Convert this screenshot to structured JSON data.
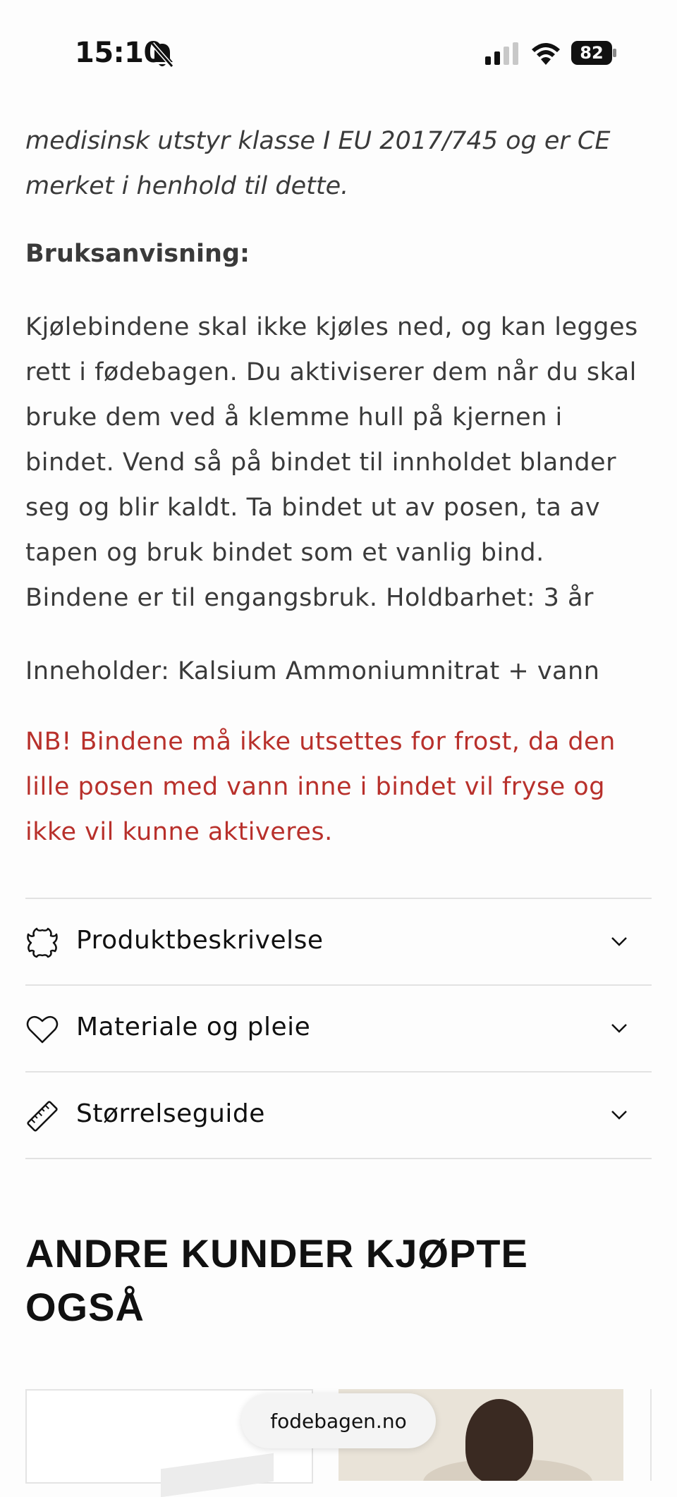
{
  "status_bar": {
    "time": "15:10",
    "battery": "82",
    "icons": [
      "bell-slash-icon",
      "cellular-signal-icon",
      "wifi-icon",
      "battery-icon"
    ]
  },
  "content": {
    "italic_lines": [
      "medisinsk utstyr klasse I EU 2017/745 og er CE",
      "merket i henhold til dette."
    ],
    "usage_heading": "Bruksanvisning:",
    "usage_text": "Kjølebindene skal ikke kjøles ned, og kan legges rett i fødebagen. Du aktiviserer dem når du skal bruke dem ved å klemme hull på kjernen i bindet. Vend så på bindet til innholdet blander seg og blir kaldt. Ta bindet ut av posen, ta av tapen og bruk bindet som et vanlig bind. Bindene er til engangsbruk. Holdbarhet: 3 år",
    "contents_text": "Inneholder: Kalsium Ammoniumnitrat + vann",
    "warning_text": "NB! Bindene må ikke utsettes for frost, da den lille posen med vann inne i bindet vil fryse og ikke vil kunne aktiveres.",
    "warning_color": "#b8302b"
  },
  "accordion": [
    {
      "label": "Produktbeskrivelse",
      "icon": "leather-icon"
    },
    {
      "label": "Materiale og pleie",
      "icon": "heart-icon"
    },
    {
      "label": "Størrelseguide",
      "icon": "ruler-icon"
    }
  ],
  "related": {
    "title": "ANDRE KUNDER KJØPTE OGSÅ"
  },
  "browser": {
    "url": "fodebagen.no"
  }
}
